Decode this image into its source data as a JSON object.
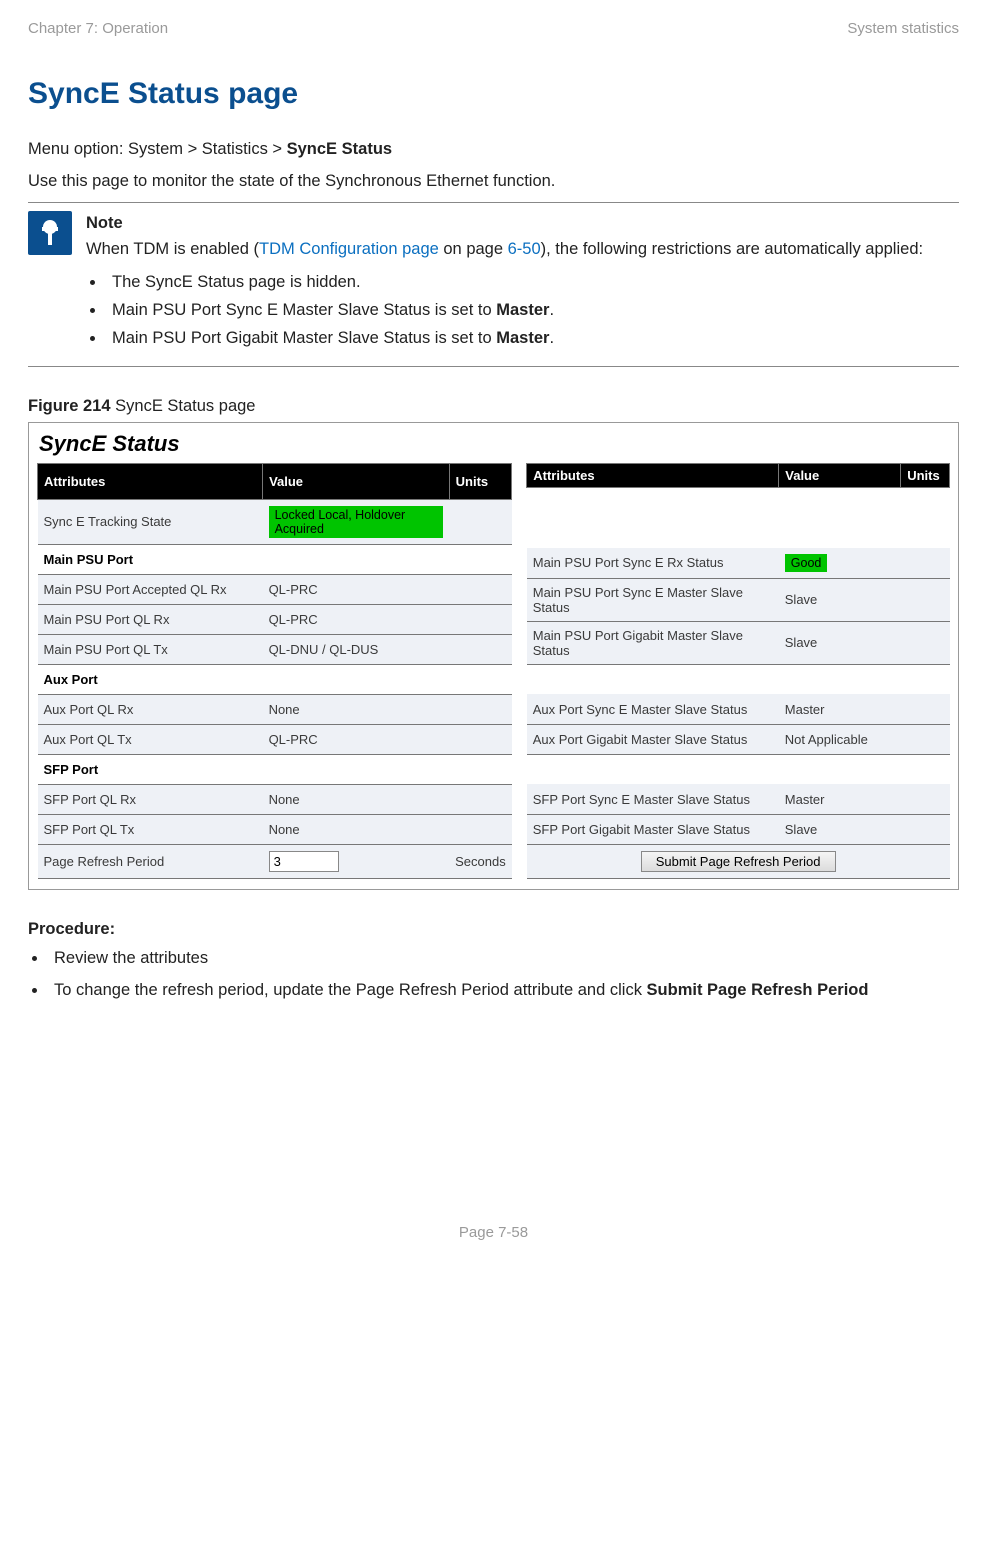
{
  "header": {
    "left": "Chapter 7:  Operation",
    "right": "System statistics"
  },
  "title": "SyncE Status page",
  "menu_line_prefix": "Menu option: System > Statistics > ",
  "menu_line_bold": "SyncE Status",
  "intro": "Use this page to monitor the state of the Synchronous Ethernet function.",
  "note": {
    "label": "Note",
    "line1_pre": "When TDM is enabled (",
    "line1_link": "TDM Configuration page",
    "line1_mid": " on page ",
    "line1_page": "6-50",
    "line1_post": "), the following restrictions are automatically applied:",
    "bullets": [
      {
        "text": "The SyncE Status page is hidden."
      },
      {
        "pre": "Main PSU Port Sync E Master Slave Status is set to ",
        "bold": "Master",
        "post": "."
      },
      {
        "pre": "Main PSU Port Gigabit Master Slave Status is set to ",
        "bold": "Master",
        "post": "."
      }
    ]
  },
  "figure": {
    "label_bold": "Figure 214",
    "label_rest": " SyncE Status page",
    "panel_title": "SyncE Status"
  },
  "table_headers": {
    "attr": "Attributes",
    "val": "Value",
    "units": "Units"
  },
  "left_rows": [
    {
      "type": "data",
      "attr": "Sync E Tracking State",
      "val": "Locked Local, Holdover Acquired",
      "green": true
    },
    {
      "type": "section",
      "attr": "Main PSU Port"
    },
    {
      "type": "data",
      "attr": "Main PSU Port Accepted QL Rx",
      "val": "QL-PRC"
    },
    {
      "type": "data",
      "attr": "Main PSU Port QL Rx",
      "val": "QL-PRC"
    },
    {
      "type": "data",
      "attr": "Main PSU Port QL Tx",
      "val": "QL-DNU / QL-DUS"
    },
    {
      "type": "section",
      "attr": "Aux Port"
    },
    {
      "type": "data",
      "attr": "Aux Port QL Rx",
      "val": "None"
    },
    {
      "type": "data",
      "attr": "Aux Port QL Tx",
      "val": "QL-PRC"
    },
    {
      "type": "section",
      "attr": "SFP Port"
    },
    {
      "type": "data",
      "attr": "SFP Port QL Rx",
      "val": "None"
    },
    {
      "type": "data",
      "attr": "SFP Port QL Tx",
      "val": "None"
    }
  ],
  "right_rows": [
    {
      "type": "empty"
    },
    {
      "type": "empty"
    },
    {
      "type": "data",
      "attr": "Main PSU Port Sync E Rx Status",
      "val": "Good",
      "green": true
    },
    {
      "type": "data",
      "attr": "Main PSU Port Sync E Master Slave Status",
      "val": "Slave"
    },
    {
      "type": "data",
      "attr": "Main PSU Port Gigabit Master Slave Status",
      "val": "Slave"
    },
    {
      "type": "empty"
    },
    {
      "type": "data",
      "attr": "Aux Port Sync E Master Slave Status",
      "val": "Master"
    },
    {
      "type": "data",
      "attr": "Aux Port Gigabit Master Slave Status",
      "val": "Not Applicable"
    },
    {
      "type": "empty"
    },
    {
      "type": "data",
      "attr": "SFP Port Sync E Master Slave Status",
      "val": "Master"
    },
    {
      "type": "data",
      "attr": "SFP Port Gigabit Master Slave Status",
      "val": "Slave"
    }
  ],
  "refresh": {
    "label": "Page Refresh Period",
    "value": "3",
    "units": "Seconds",
    "button": "Submit Page Refresh Period"
  },
  "procedure": {
    "heading": "Procedure:",
    "items": [
      {
        "text": "Review the attributes"
      },
      {
        "pre": "To change the refresh period, update the Page Refresh Period attribute and click ",
        "bold": "Submit Page Refresh Period"
      }
    ]
  },
  "footer": "Page 7-58"
}
